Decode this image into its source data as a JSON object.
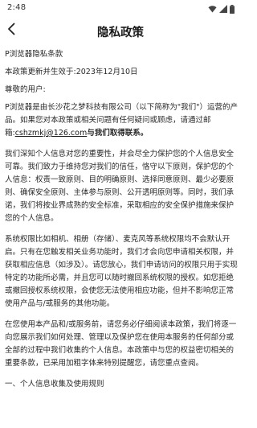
{
  "status": {
    "time": "2:48",
    "icons": [
      "wifi-icon",
      "signal-icon",
      "battery-icon"
    ]
  },
  "header": {
    "title": "隐私政策",
    "back_icon": "chevron-left-icon"
  },
  "content": {
    "policy_name": "P浏览器隐私条款",
    "updated": "本政策更新并生效于:2023年12月10日",
    "greeting": "尊敬的用户:",
    "intro_1": "P浏览器是由长沙花之梦科技有限公司（以下简称为\"我们\"）运营的产品。如果您对本政策或相关问题有任何疑问或顾虑，请通过邮箱:",
    "email": "cshzmkj@126.com",
    "intro_1_tail": "与我们取得联系。",
    "para_2": "我们深知个人信息对您的重要性，并会尽全力保护您的个人信息安全可靠。我们致力于维持您对我们的信任，恪守以下原则，保护您的个人信息：权责一致原则、目的明确原则、选择同意原则、最少必要原则、确保安全原则、主体参与原则、公开透明原则等。同时，我们承诺，我们将按业界成熟的安全标准，采取相应的安全保护措施来保护您的个人信息。",
    "para_3": "系统权限比如相机、相册（存储）、麦克风等系统权限均不会默认开启。只有在您触发相关业务功能时，我们才会向您申请相关权限，并获取相应信息（如涉及）。请您放心，我们申请访问的权限只用于实现特定的功能所必需，并且您可以随时撤回系统权限的授权。如您拒绝或撤回授权系统权限，会使您无法使用相应功能，但并不影响您正常使用产品与/或服务的其他功能。",
    "para_4": "在您使用本产品和/或服务前，请您务必仔细阅读本政策，我们将逐一向您展示我们如何处理、管理以及保护您在使用本服务的任何部分或全部的过程中我们收集的个人信息。本政策中与您的权益密切相关的重要条款，已采用加粗字体来特别提醒您，请您重点查阅。",
    "section_1": "一、个人信息收集及使用规则"
  }
}
